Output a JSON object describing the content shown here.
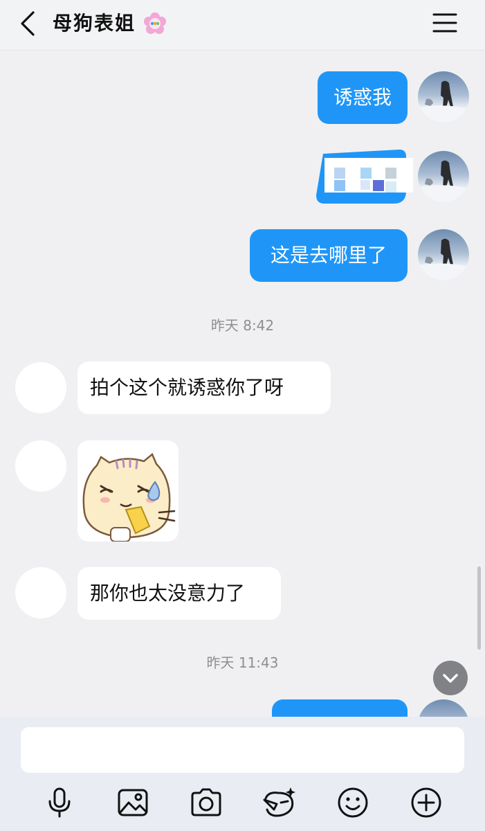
{
  "header": {
    "title": "母狗表姐"
  },
  "messages": {
    "m1": "诱惑我",
    "m3": "这是去哪里了",
    "m4": "拍个这个就诱惑你了呀",
    "m5": "那你也太没意力了"
  },
  "timestamps": {
    "t1": "昨天 8:42",
    "t2": "昨天 11:43"
  },
  "input": {
    "value": ""
  },
  "toolbar_icons": [
    "microphone-icon",
    "image-icon",
    "camera-icon",
    "face-effect-icon",
    "emoji-icon",
    "add-icon"
  ],
  "colors": {
    "outgoing_bubble": "#1f96f7",
    "incoming_bubble": "#ffffff",
    "background": "#f0f0f2"
  }
}
